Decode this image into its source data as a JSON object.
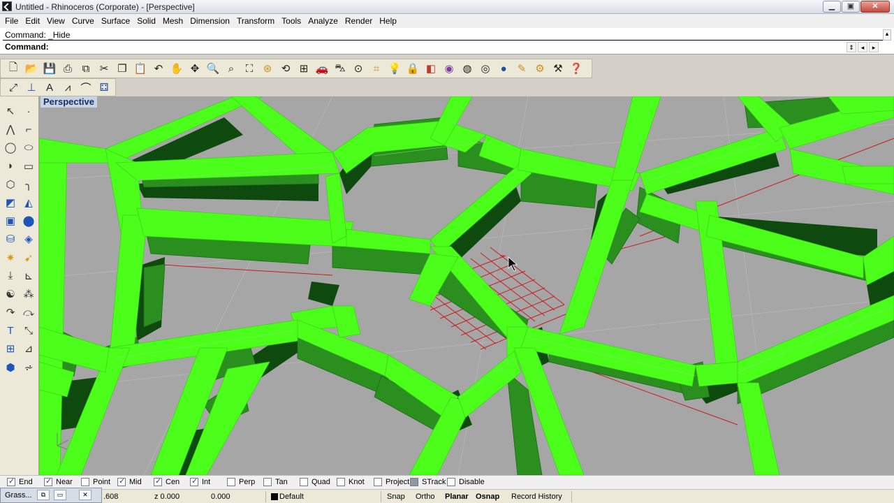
{
  "window": {
    "title": "Untitled - Rhinoceros (Corporate) - [Perspective]",
    "min_glyph": "▁",
    "max_glyph": "▣",
    "close_glyph": "✕"
  },
  "menu": [
    "File",
    "Edit",
    "View",
    "Curve",
    "Surface",
    "Solid",
    "Mesh",
    "Dimension",
    "Transform",
    "Tools",
    "Analyze",
    "Render",
    "Help"
  ],
  "command": {
    "history": "Command: _Hide",
    "prompt": "Command:"
  },
  "toolbar_icons": [
    "new-file-icon",
    "open-folder-icon",
    "save-icon",
    "print-icon",
    "export-icon",
    "cut-icon",
    "copy-icon",
    "paste-icon",
    "undo-icon",
    "pan-hand-icon",
    "rotate-view-icon",
    "zoom-icon",
    "zoom-window-icon",
    "zoom-extents-icon",
    "zoom-selected-icon",
    "rotate-icon",
    "four-viewports-icon",
    "car-icon",
    "car-wireframe-icon",
    "point-snap-icon",
    "grid-snap-icon",
    "light-bulb-icon",
    "lock-icon",
    "layer-icon",
    "color-wheel-icon",
    "sphere-wire-icon",
    "sphere-shaded-icon",
    "sphere-render-icon",
    "render-icon",
    "gear-options-icon",
    "properties-icon",
    "help-icon"
  ],
  "toolbar2_icons": [
    "select-points-icon",
    "gumball-icon",
    "text-object-icon",
    "curve-tools-icon",
    "surface-tools-icon",
    "mesh-tools-icon"
  ],
  "left_icons": [
    [
      "select-arrow-icon",
      "point-icon"
    ],
    [
      "polyline-icon",
      "curve-control-icon"
    ],
    [
      "circle-icon",
      "ellipse-icon"
    ],
    [
      "arc-icon",
      "rectangle-icon"
    ],
    [
      "polygon-icon",
      "fillet-curve-icon"
    ],
    [
      "surface-corner-icon",
      "loft-icon"
    ],
    [
      "box-icon",
      "sphere-icon"
    ],
    [
      "cylinder-icon",
      "mesh-icon"
    ],
    [
      "trim-icon",
      "extend-icon"
    ],
    [
      "split-icon",
      "offset-icon"
    ],
    [
      "boolean-icon",
      "group-icon"
    ],
    [
      "fillet-icon",
      "chamfer-icon"
    ],
    [
      "text-icon",
      "dimension-icon"
    ],
    [
      "array-icon",
      "mirror-icon"
    ],
    [
      "render-box-icon",
      "grasshopper-icon"
    ]
  ],
  "viewport": {
    "label": "Perspective",
    "background": "#a6a6a6",
    "mesh_color": "#4cff1a",
    "side_color": "#2a8f1f",
    "dark_color": "#0e4a0e",
    "grid_color": "#c81e1e"
  },
  "osnap": [
    {
      "label": "End",
      "state": "on"
    },
    {
      "label": "Near",
      "state": "on"
    },
    {
      "label": "Point",
      "state": "off"
    },
    {
      "label": "Mid",
      "state": "on"
    },
    {
      "label": "Cen",
      "state": "on"
    },
    {
      "label": "Int",
      "state": "on"
    },
    {
      "label": "Perp",
      "state": "off"
    },
    {
      "label": "Tan",
      "state": "off"
    },
    {
      "label": "Quad",
      "state": "off"
    },
    {
      "label": "Knot",
      "state": "off"
    },
    {
      "label": "Project",
      "state": "off"
    },
    {
      "label": "STrack",
      "state": "filled"
    },
    {
      "label": "Disable",
      "state": "off"
    }
  ],
  "status": {
    "x_value": ".608",
    "z_value": "z 0.000",
    "extra_value": "0.000",
    "layer": "Default",
    "snap": "Snap",
    "ortho": "Ortho",
    "planar": "Planar",
    "osnap": "Osnap",
    "record_history": "Record History"
  },
  "grasshopper_popup": {
    "label": "Grass...",
    "restore_glyph": "⧉",
    "max_glyph": "▭",
    "close_glyph": "✕"
  }
}
